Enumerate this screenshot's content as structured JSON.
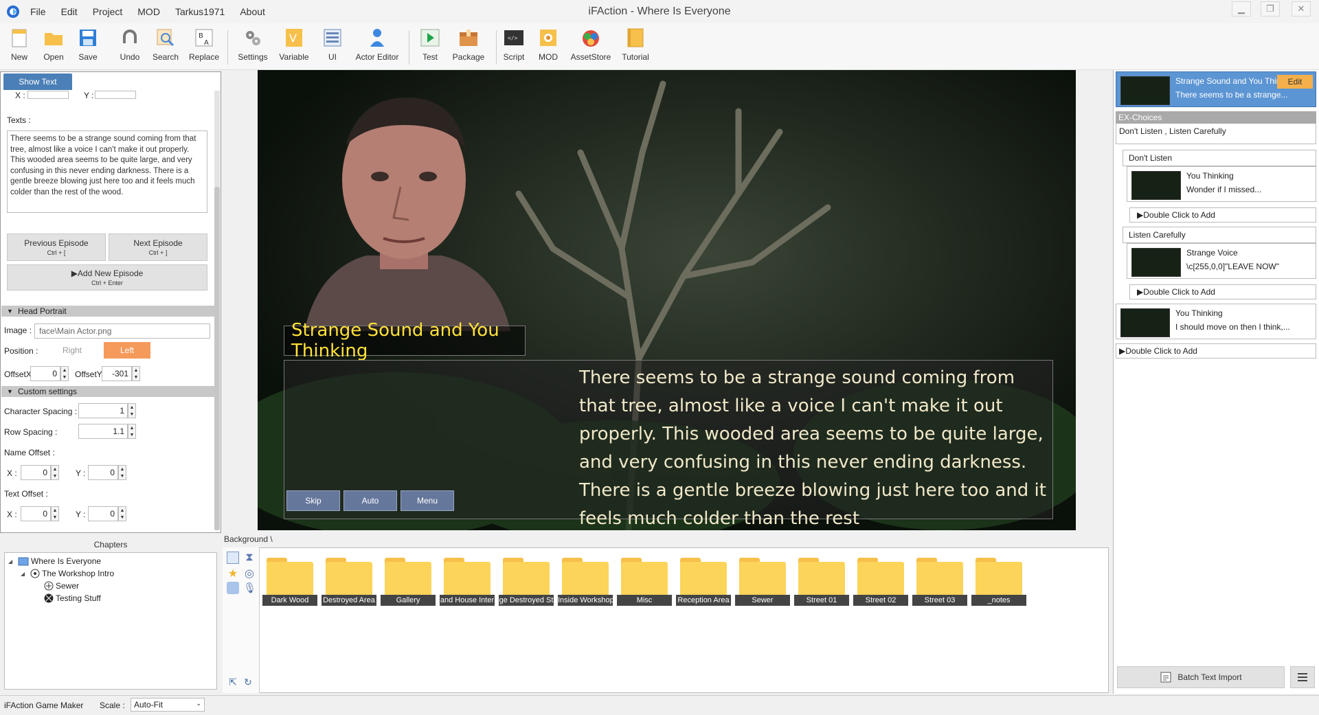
{
  "window": {
    "title": "iFAction - Where Is Everyone",
    "menu": [
      "File",
      "Edit",
      "Project",
      "MOD",
      "Tarkus1971",
      "About"
    ]
  },
  "toolbar": {
    "items": [
      "New",
      "Open",
      "Save",
      "Undo",
      "Search",
      "Replace",
      "Settings",
      "Variable",
      "UI",
      "Actor Editor",
      "Test",
      "Package",
      "Script",
      "MOD",
      "AssetStore",
      "Tutorial"
    ]
  },
  "left_panel": {
    "tab": "Show Text",
    "x_label": "X :",
    "y_label": "Y :",
    "texts_label": "Texts :",
    "texts_value": "There seems to be a strange sound coming from that tree, almost like a voice I can't make it out properly. This wooded area seems to be quite large, and very confusing in this never ending darkness.  There is a gentle breeze blowing just here too and it feels much colder than the rest of the wood.",
    "prev_episode": "Previous Episode",
    "prev_shortcut": "Ctrl + [",
    "next_episode": "Next Episode",
    "next_shortcut": "Ctrl + ]",
    "add_episode": "▶Add New Episode",
    "add_shortcut": "Ctrl + Enter",
    "head_portrait": {
      "title": "Head Portrait",
      "image_label": "Image :",
      "image_value": "face\\Main Actor.png",
      "position_label": "Position :",
      "pos_right": "Right",
      "pos_left": "Left",
      "offsetx_label": "OffsetX",
      "offsetx": "0",
      "offsety_label": "OffsetY",
      "offsety": "-301"
    },
    "custom_settings": {
      "title": "Custom settings",
      "char_spacing_label": "Character Spacing :",
      "char_spacing": "1",
      "row_spacing_label": "Row Spacing :",
      "row_spacing": "1.1",
      "name_offset_label": "Name Offset :",
      "name_x": "0",
      "name_y": "0",
      "text_offset_label": "Text Offset :",
      "text_x": "0",
      "text_y": "0"
    }
  },
  "chapters": {
    "title": "Chapters",
    "tree": [
      "Where Is Everyone",
      "The Workshop Intro",
      "Sewer",
      "Testing Stuff"
    ]
  },
  "preview": {
    "name": "Strange Sound and You Thinking",
    "dialog": "There seems to be a strange sound coming from that tree, almost like a voice I can't make it out properly. This wooded area seems to be quite large, and very confusing in this never ending darkness.  There is a gentle breeze blowing just here too and it feels much colder than the rest",
    "buttons": [
      "Skip",
      "Auto",
      "Menu"
    ]
  },
  "right_panel": {
    "selected": {
      "title": "Strange Sound and You Think",
      "text": "There seems to be a strange...",
      "edit": "Edit"
    },
    "ex_choices": "EX-Choices",
    "choices_summary": "Don't Listen , Listen Carefully",
    "choice1": "Don't Listen",
    "choice1_epi": {
      "title": "You Thinking",
      "text": "Wonder if I missed..."
    },
    "choice2": "Listen Carefully",
    "choice2_epi": {
      "title": "Strange Voice",
      "text": "\\c[255,0,0]\"LEAVE NOW\""
    },
    "double_click_add": "▶Double Click to Add",
    "after_epi": {
      "title": "You Thinking",
      "text": "I should move on then I think,..."
    },
    "batch_import": "Batch Text Import"
  },
  "assets": {
    "path": "Background \\",
    "folders": [
      "Dark Wood",
      "Destroyed Area",
      "Gallery",
      "and House Inter",
      "ge Destroyed St",
      "Inside Workshop",
      "Misc",
      "Reception Area",
      "Sewer",
      "Street 01",
      "Street 02",
      "Street 03",
      "_notes"
    ]
  },
  "statusbar": {
    "app": "iFAction Game Maker",
    "scale_label": "Scale :",
    "scale_value": "Auto-Fit"
  }
}
